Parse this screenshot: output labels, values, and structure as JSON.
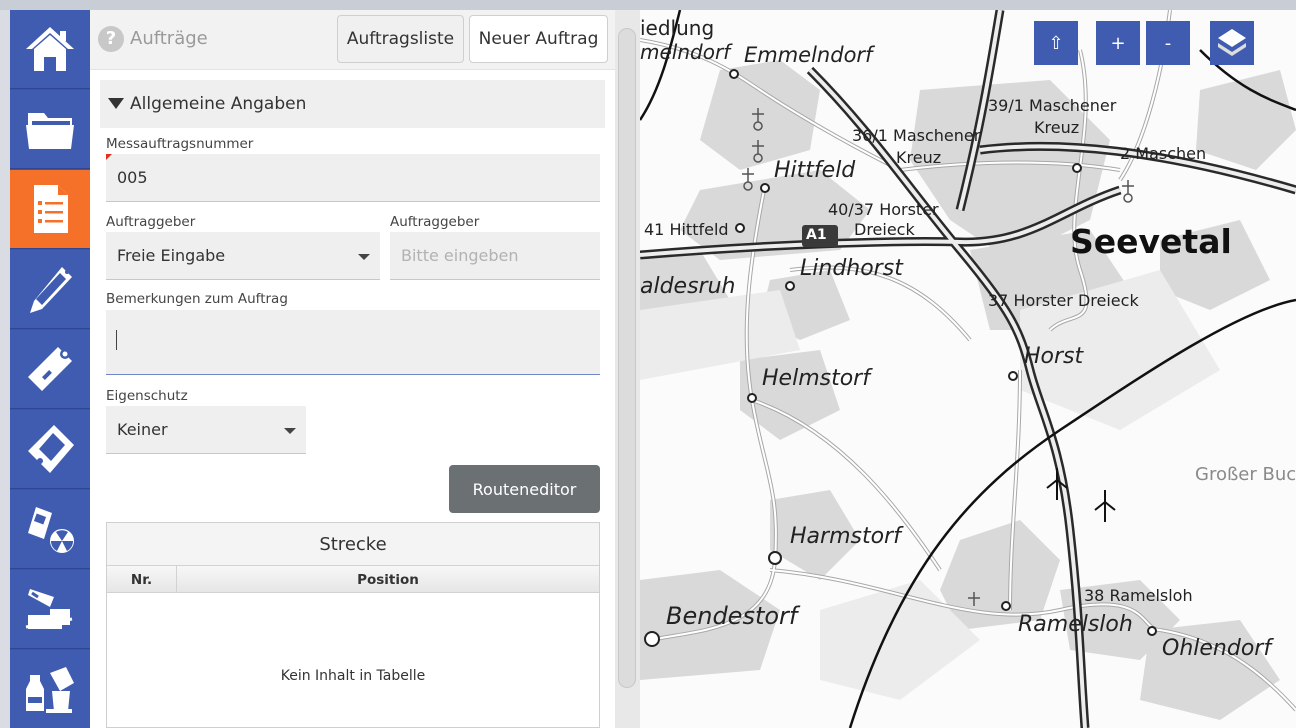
{
  "app": {
    "nav": [
      {
        "name": "home"
      },
      {
        "name": "folder"
      },
      {
        "name": "clipboard-list",
        "active": true
      },
      {
        "name": "probe-pen"
      },
      {
        "name": "measuring-wand"
      },
      {
        "name": "handheld-meter"
      },
      {
        "name": "radiation-device"
      },
      {
        "name": "wind-sampling"
      },
      {
        "name": "lab-sample"
      }
    ]
  },
  "panel": {
    "title": "Aufträge",
    "buttons": {
      "list": "Auftragsliste",
      "new": "Neuer Auftrag"
    },
    "section": "Allgemeine Angaben",
    "fields": {
      "order_number_label": "Messauftragsnummer",
      "order_number_value": "005",
      "client_label": "Auftraggeber",
      "client_select": "Freie Eingabe",
      "client_text_label": "Auftraggeber",
      "client_text_placeholder": "Bitte eingeben",
      "remarks_label": "Bemerkungen zum Auftrag",
      "remarks_value": "",
      "self_protection_label": "Eigenschutz",
      "self_protection_value": "Keiner"
    },
    "route_editor": "Routeneditor",
    "table": {
      "title": "Strecke",
      "columns": [
        "Nr.",
        "Position"
      ],
      "empty": "Kein Inhalt in Tabelle"
    }
  },
  "map": {
    "controls": {
      "north": "⇧",
      "zoom_in": "+",
      "zoom_out": "-"
    },
    "labels": {
      "siedlung": "iedlung",
      "emmelndorf_w": "melndorf",
      "emmelndorf": "Emmelndorf",
      "maschener_kreuz_39": "39/1 Maschener",
      "kreuz_a": "Kreuz",
      "maschener_kreuz_36": "36/1 Maschener",
      "kreuz_b": "Kreuz",
      "maschen": "2 Maschen",
      "hittfeld": "Hittfeld",
      "horster_dreieck_40": "40/37 Horster",
      "dreieck": "Dreieck",
      "hittfeld_41": "41 Hittfeld",
      "a1": "A1",
      "seevetal": "Seevetal",
      "lindhorst": "Lindhorst",
      "aldesruh": "aldesruh",
      "horster_dreieck_37": "37 Horster Dreieck",
      "horst": "Horst",
      "helmstorf": "Helmstorf",
      "grosser_buch": "Großer Buch",
      "harmstorf": "Harmstorf",
      "bendestorf": "Bendestorf",
      "ramelsloh_38": "38 Ramelsloh",
      "ramelsloh": "Ramelsloh",
      "ohlendorf": "Ohlendorf"
    }
  }
}
